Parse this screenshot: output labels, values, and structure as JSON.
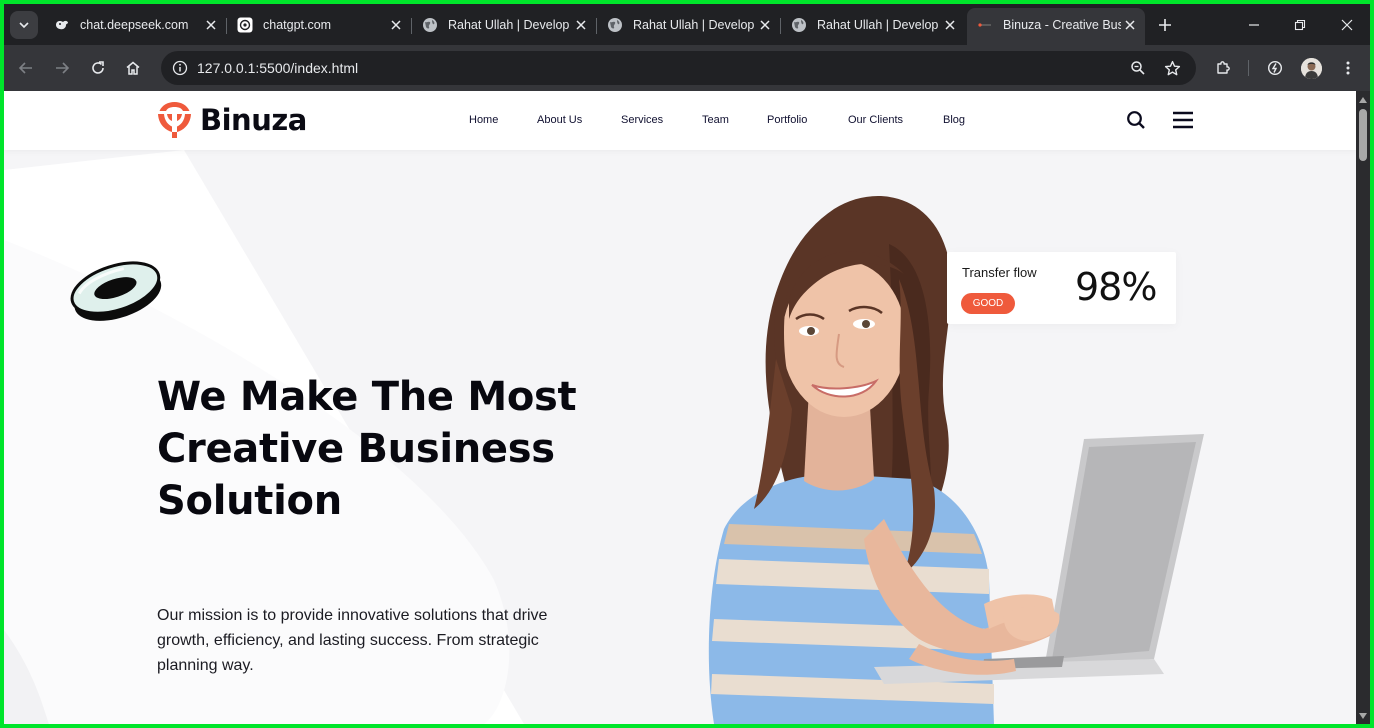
{
  "browser": {
    "tabs": [
      {
        "title": "chat.deepseek.com",
        "icon": "deepseek-whale-icon"
      },
      {
        "title": "chatgpt.com",
        "icon": "chatgpt-icon"
      },
      {
        "title": "Rahat Ullah | Develop",
        "icon": "globe-icon"
      },
      {
        "title": "Rahat Ullah | Develop",
        "icon": "globe-icon"
      },
      {
        "title": "Rahat Ullah | Develop",
        "icon": "globe-icon"
      },
      {
        "title": "Binuza - Creative Busi",
        "icon": "site-favicon",
        "active": true
      }
    ],
    "url": "127.0.0.1:5500/index.html"
  },
  "site": {
    "brand": "Binuza",
    "nav": [
      "Home",
      "About Us",
      "Services",
      "Team",
      "Portfolio",
      "Our Clients",
      "Blog"
    ],
    "hero": {
      "title_lines": [
        "We Make The Most",
        "Creative Business",
        "Solution"
      ],
      "subtitle_lines": [
        "Our mission is to provide innovative solutions that drive",
        "growth, efficiency, and lasting success. From strategic",
        "planning way."
      ]
    },
    "stat_card": {
      "label": "Transfer flow",
      "badge": "GOOD",
      "value": "98%"
    }
  },
  "colors": {
    "accent": "#ef5a3c",
    "frame": "#00e52b",
    "chrome_dark": "#202124",
    "chrome_toolbar": "#35363a",
    "hero_bg": "#f5f5f7",
    "text_dark": "#08080f"
  }
}
